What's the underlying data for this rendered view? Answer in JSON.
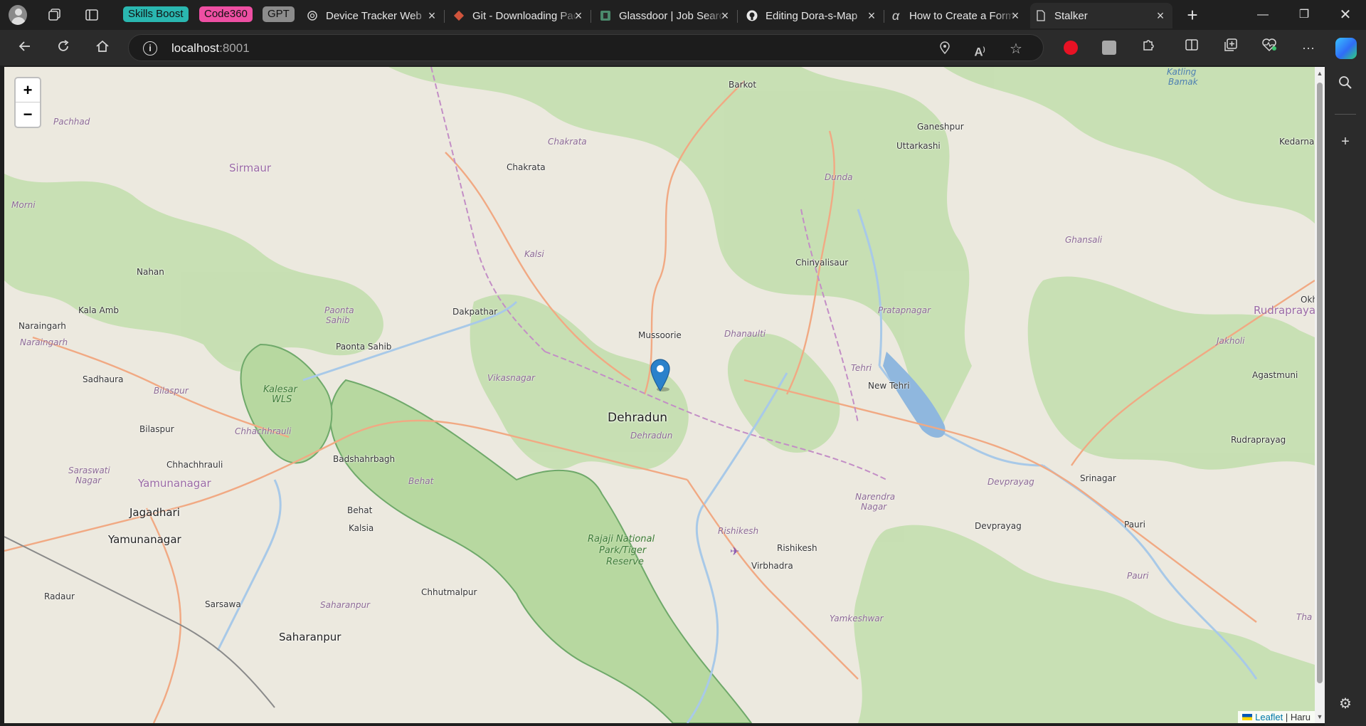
{
  "tab_groups": [
    {
      "label": "Skills Boost",
      "color": "#2ab7b0"
    },
    {
      "label": "Code360",
      "color": "#ee4fa3"
    },
    {
      "label": "GPT",
      "color": "#8c8c8c"
    }
  ],
  "tabs": [
    {
      "title": "Device Tracker Web",
      "icon": "openai-icon"
    },
    {
      "title": "Git - Downloading Package",
      "icon": "git-icon"
    },
    {
      "title": "Glassdoor | Job Search",
      "icon": "glassdoor-icon"
    },
    {
      "title": "Editing Dora-s-Map",
      "icon": "github-icon"
    },
    {
      "title": "How to Create a Form",
      "icon": "alpha-icon"
    },
    {
      "title": "Stalker",
      "icon": "page-icon",
      "active": true
    }
  ],
  "address": {
    "host": "localhost",
    "port": ":8001"
  },
  "map": {
    "zoom_in": "+",
    "zoom_out": "−",
    "attribution": {
      "leaflet": "Leaflet",
      "separator": " | ",
      "rest": "Haru"
    },
    "marker": {
      "icon": "map-pin-icon",
      "color": "#2a81cb"
    },
    "places": {
      "barkot": "Barkot",
      "katling": "Katling",
      "bamak": "Bamak",
      "pachhad": "Pachhad",
      "chakrata_it": "Chakrata",
      "ganeshpur": "Ganeshpur",
      "uttarkashi": "Uttarkashi",
      "kedarnath": "Kedarna",
      "sirmaur": "Sirmaur",
      "chakrata": "Chakrata",
      "dunda": "Dunda",
      "morni": "Morni",
      "ghansali": "Ghansali",
      "kalsi": "Kalsi",
      "chinyalisaur": "Chinyalisaur",
      "nahan": "Nahan",
      "okh": "Okh",
      "kala_amb": "Kala Amb",
      "paonta_it_1": "Paonta",
      "paonta_it_2": "Sahib",
      "dakpathar": "Dakpathar",
      "pratapnagar": "Pratapnagar",
      "rudraprayag_dist": "Rudraprayag",
      "naraingarh": "Naraingarh",
      "naraingarh_it": "Naraingarh",
      "mussoorie": "Mussoorie",
      "dhanaulti": "Dhanaulti",
      "jakholi": "Jakholi",
      "paonta_sahib": "Paonta Sahib",
      "tehri": "Tehri",
      "agastmuni": "Agastmuni",
      "sadhaura": "Sadhaura",
      "vikasnagar": "Vikasnagar",
      "new_tehri": "New Tehri",
      "kalesar_1": "Kalesar",
      "kalesar_2": "WLS",
      "bilaspur_it": "Bilaspur",
      "dehradun": "Dehradun",
      "dehradun_it": "Dehradun",
      "bilaspur": "Bilaspur",
      "chhachhrauli_it": "Chhachhrauli",
      "rudraprayag": "Rudraprayag",
      "badshahrbagh": "Badshahrbagh",
      "chhachhrauli": "Chhachhrauli",
      "saraswati_1": "Saraswati",
      "saraswati_2": "Nagar",
      "yamunanagar_dist": "Yamunanagar",
      "behat_it": "Behat",
      "srinagar": "Srinagar",
      "devprayag_it": "Devprayag",
      "narendra_1": "Narendra",
      "narendra_2": "Nagar",
      "behat": "Behat",
      "jagadhari": "Jagadhari",
      "pauri": "Pauri",
      "devprayag": "Devprayag",
      "kalsia": "Kalsia",
      "rishikesh_it": "Rishikesh",
      "yamunanagar": "Yamunanagar",
      "rajaji_1": "Rajaji National",
      "rajaji_2": "Park/Tiger",
      "rajaji_3": "Reserve",
      "rishikesh": "Rishikesh",
      "virbhadra": "Virbhadra",
      "pauri_it": "Pauri",
      "chhutmalpur": "Chhutmalpur",
      "radaur": "Radaur",
      "sarsawa": "Sarsawa",
      "saharanpur_it": "Saharanpur",
      "yamkeshwar": "Yamkeshwar",
      "saharanpur": "Saharanpur",
      "tha": "Tha"
    }
  }
}
